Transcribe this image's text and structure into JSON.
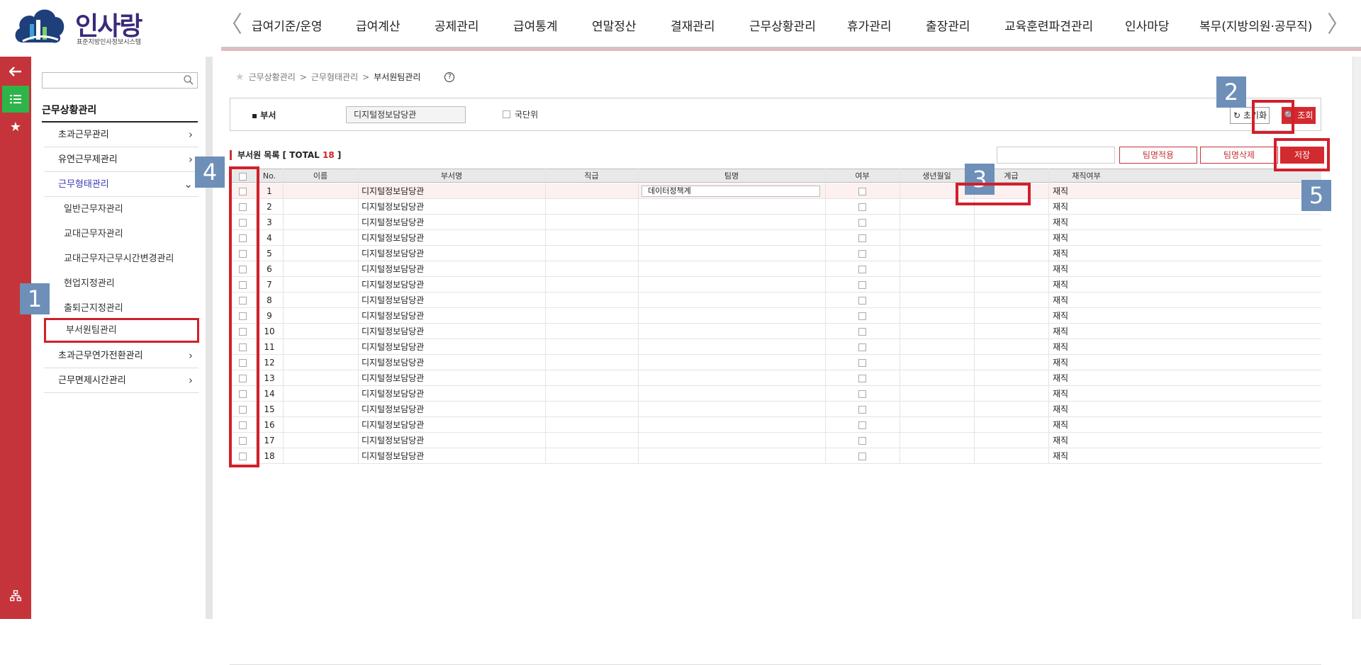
{
  "header": {
    "logo_text": "인사랑",
    "logo_sub": "표준지방인사정보시스템",
    "nav_prev": "〈",
    "nav_next": "〉",
    "nav_items": [
      "급여기준/운영",
      "급여계산",
      "공제관리",
      "급여통계",
      "연말정산",
      "결재관리",
      "근무상황관리",
      "휴가관리",
      "출장관리",
      "교육훈련파견관리",
      "인사마당",
      "복무(지방의원·공무직)"
    ]
  },
  "rail": {
    "icons": [
      "arrow-left-icon",
      "list-icon",
      "star-icon",
      "sitemap-icon"
    ]
  },
  "sidebar": {
    "search_placeholder": "",
    "title": "근무상황관리",
    "items": [
      {
        "label": "초과근무관리",
        "chevron": "›"
      },
      {
        "label": "유연근무제관리",
        "chevron": "›"
      },
      {
        "label": "근무형태관리",
        "chevron": "⌄"
      },
      {
        "label": "초과근무연가전환관리",
        "chevron": "›"
      },
      {
        "label": "근무면제시간관리",
        "chevron": "›"
      }
    ],
    "subitems": [
      "일반근무자관리",
      "교대근무자관리",
      "교대근무자근무시간변경관리",
      "현업지정관리",
      "출퇴근지정관리",
      "부서원팀관리"
    ]
  },
  "breadcrumb": {
    "path1": "근무상황관리",
    "sep": ">",
    "path2": "근무형태관리",
    "current": "부서원팀관리",
    "help": "?"
  },
  "filter": {
    "dept_label": "▪ 부서",
    "dept_value": "디지털정보담당관",
    "check_label": "국단위",
    "reset_label": "↻ 초기화",
    "search_label": "🔍 조회"
  },
  "list": {
    "title": "부서원 목록 [ TOTAL ",
    "total": "18",
    "title_end": " ]",
    "apply_label": "팀명적용",
    "delete_label": "팀명삭제",
    "save_label": "저장"
  },
  "grid": {
    "headers": [
      "No.",
      "이름",
      "부서명",
      "직급",
      "팀명",
      "여부",
      "생년월일",
      "계급",
      "재직여부"
    ],
    "first_team": "데이터정책계",
    "rows": [
      {
        "no": "1",
        "dept": "디지털정보담당관",
        "status": "재직"
      },
      {
        "no": "2",
        "dept": "디지털정보담당관",
        "status": "재직"
      },
      {
        "no": "3",
        "dept": "디지털정보담당관",
        "status": "재직"
      },
      {
        "no": "4",
        "dept": "디지털정보담당관",
        "status": "재직"
      },
      {
        "no": "5",
        "dept": "디지털정보담당관",
        "status": "재직"
      },
      {
        "no": "6",
        "dept": "디지털정보담당관",
        "status": "재직"
      },
      {
        "no": "7",
        "dept": "디지털정보담당관",
        "status": "재직"
      },
      {
        "no": "8",
        "dept": "디지털정보담당관",
        "status": "재직"
      },
      {
        "no": "9",
        "dept": "디지털정보담당관",
        "status": "재직"
      },
      {
        "no": "10",
        "dept": "디지털정보담당관",
        "status": "재직"
      },
      {
        "no": "11",
        "dept": "디지털정보담당관",
        "status": "재직"
      },
      {
        "no": "12",
        "dept": "디지털정보담당관",
        "status": "재직"
      },
      {
        "no": "13",
        "dept": "디지털정보담당관",
        "status": "재직"
      },
      {
        "no": "14",
        "dept": "디지털정보담당관",
        "status": "재직"
      },
      {
        "no": "15",
        "dept": "디지털정보담당관",
        "status": "재직"
      },
      {
        "no": "16",
        "dept": "디지털정보담당관",
        "status": "재직"
      },
      {
        "no": "17",
        "dept": "디지털정보담당관",
        "status": "재직"
      },
      {
        "no": "18",
        "dept": "디지털정보담당관",
        "status": "재직"
      }
    ]
  },
  "annotations": [
    "1",
    "2",
    "3",
    "4",
    "5"
  ],
  "colors": {
    "accent": "#c4343a",
    "rail_active": "#2db54a",
    "callout": "#6d8fb8"
  }
}
